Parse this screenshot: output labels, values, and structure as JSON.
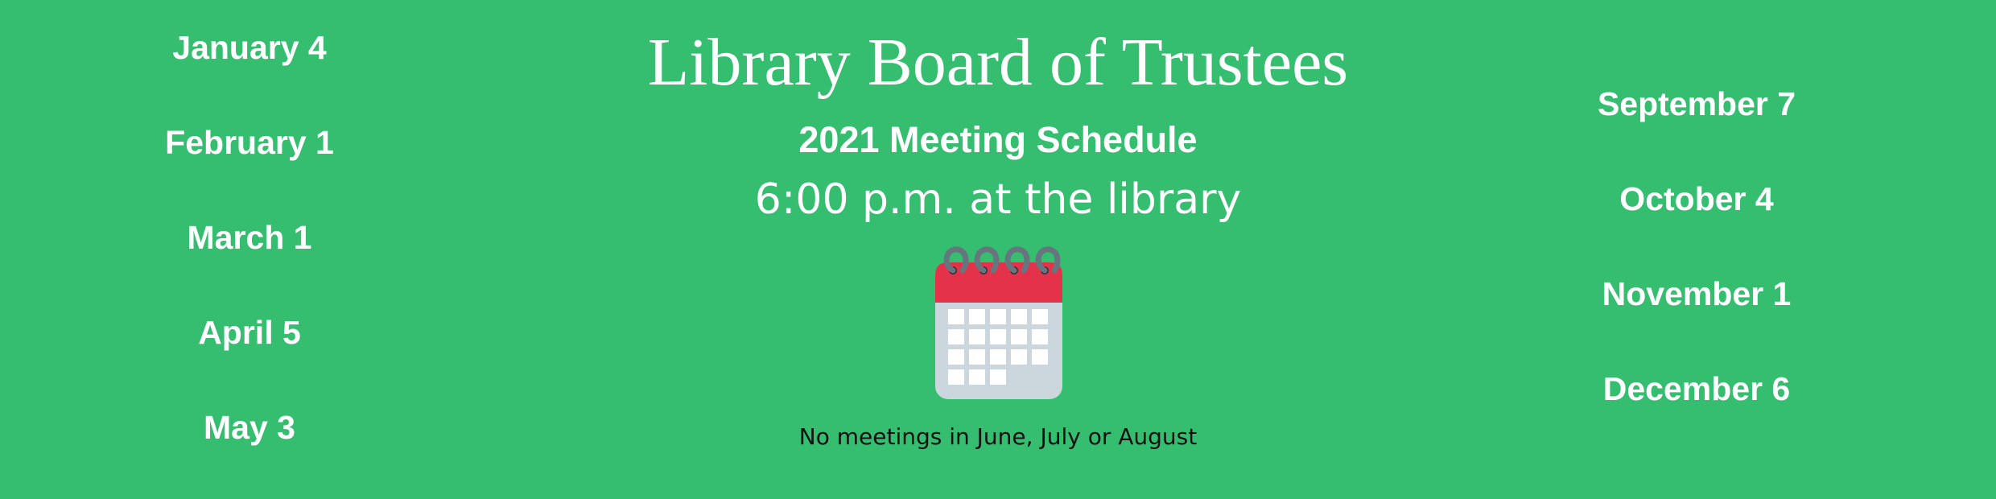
{
  "title": "Library Board of Trustees",
  "subtitle": "2021 Meeting Schedule",
  "time_location": "6:00 p.m. at the library",
  "left_dates": [
    "January 4",
    "February 1",
    "March 1",
    "April 5",
    "May 3"
  ],
  "right_dates": [
    "September 7",
    "October 4",
    "November 1",
    "December 6"
  ],
  "note": "No meetings in June, July or August",
  "icon": "calendar-icon",
  "colors": {
    "background": "#35bd70",
    "text": "#ffffff",
    "note_text": "#111111",
    "calendar_header": "#e3324a",
    "calendar_body": "#ccd6dd",
    "calendar_rings": "#67757f"
  }
}
